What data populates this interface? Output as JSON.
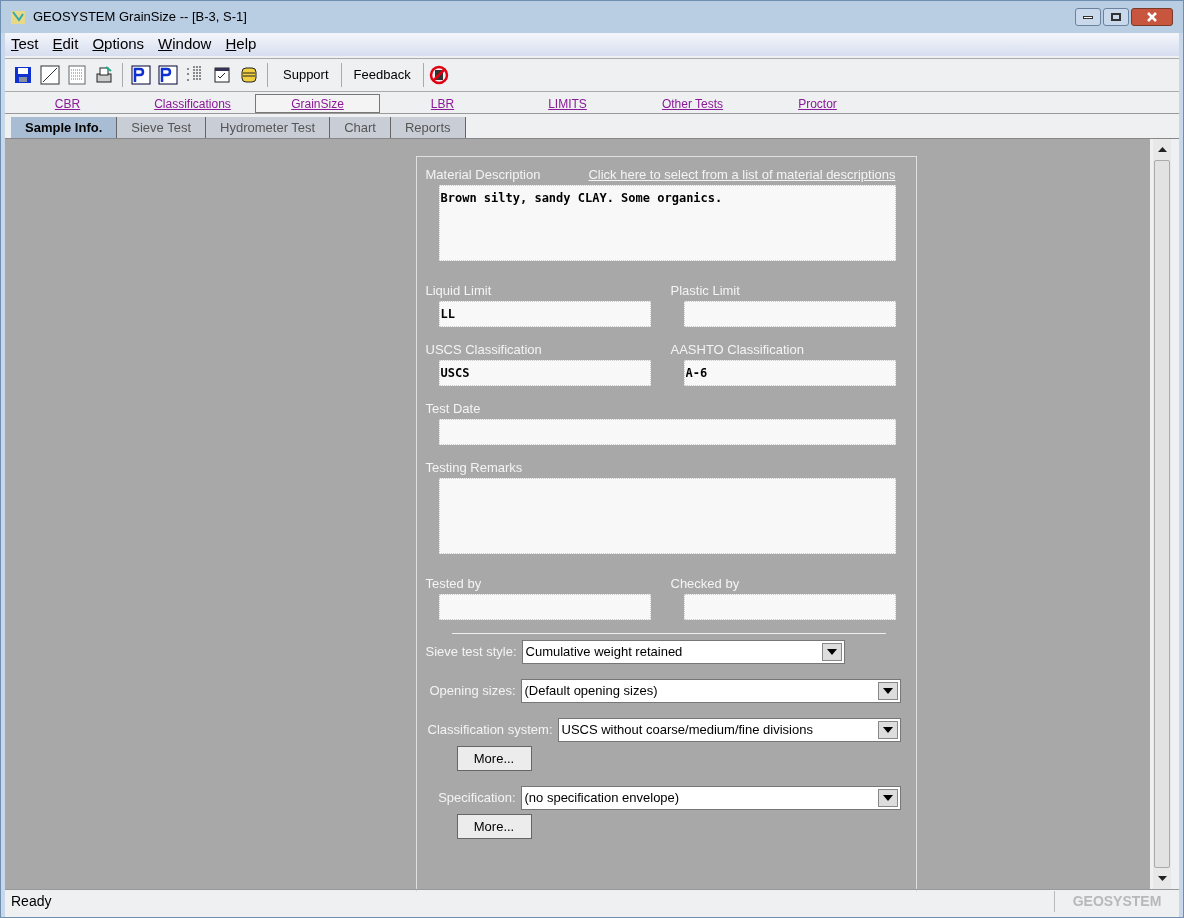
{
  "window": {
    "title": "GEOSYSTEM GrainSize -- [B-3, S-1]"
  },
  "menu": [
    "Test",
    "Edit",
    "Options",
    "Window",
    "Help"
  ],
  "toolbar": {
    "text_buttons": [
      "Support",
      "Feedback"
    ]
  },
  "test_links": [
    {
      "label": "CBR",
      "selected": false
    },
    {
      "label": "Classifications",
      "selected": false
    },
    {
      "label": "GrainSize",
      "selected": true
    },
    {
      "label": "LBR",
      "selected": false
    },
    {
      "label": "LIMITS",
      "selected": false
    },
    {
      "label": "Other Tests",
      "selected": false
    },
    {
      "label": "Proctor",
      "selected": false
    }
  ],
  "tabs": [
    {
      "label": "Sample Info.",
      "selected": true
    },
    {
      "label": "Sieve Test",
      "selected": false
    },
    {
      "label": "Hydrometer Test",
      "selected": false
    },
    {
      "label": "Chart",
      "selected": false
    },
    {
      "label": "Reports",
      "selected": false
    }
  ],
  "form": {
    "link": "Click here to select from a list of material descriptions",
    "rows": [
      [
        {
          "kind": "area",
          "label": "Material Description",
          "value": "Brown silty, sandy CLAY. Some organics."
        }
      ],
      [
        {
          "kind": "text",
          "label": "Liquid Limit",
          "value": "LL"
        },
        {
          "kind": "text",
          "label": "Plastic Limit"
        }
      ],
      [
        {
          "kind": "text",
          "label": "USCS Classification",
          "value": "USCS"
        },
        {
          "kind": "text",
          "label": "AASHTO Classification",
          "value": "A-6"
        }
      ],
      [
        {
          "kind": "text",
          "label": "Test Date"
        }
      ],
      [
        {
          "kind": "area",
          "label": "Testing Remarks"
        }
      ],
      [
        {
          "kind": "text",
          "label": "Tested by"
        },
        {
          "kind": "text",
          "label": "Checked by"
        }
      ]
    ],
    "selects": [
      {
        "label": "Sieve test style:",
        "value": "Cumulative weight retained"
      },
      {
        "label": "Opening sizes:",
        "value": "(Default opening sizes)"
      },
      {
        "label": "Classification system:",
        "value": "USCS without coarse/medium/fine divisions",
        "more": "More..."
      },
      {
        "label": "Specification:",
        "value": "(no specification envelope)",
        "more": "More..."
      }
    ]
  },
  "status_bar": {
    "message": "Ready",
    "brand": "GEOSYSTEM"
  }
}
